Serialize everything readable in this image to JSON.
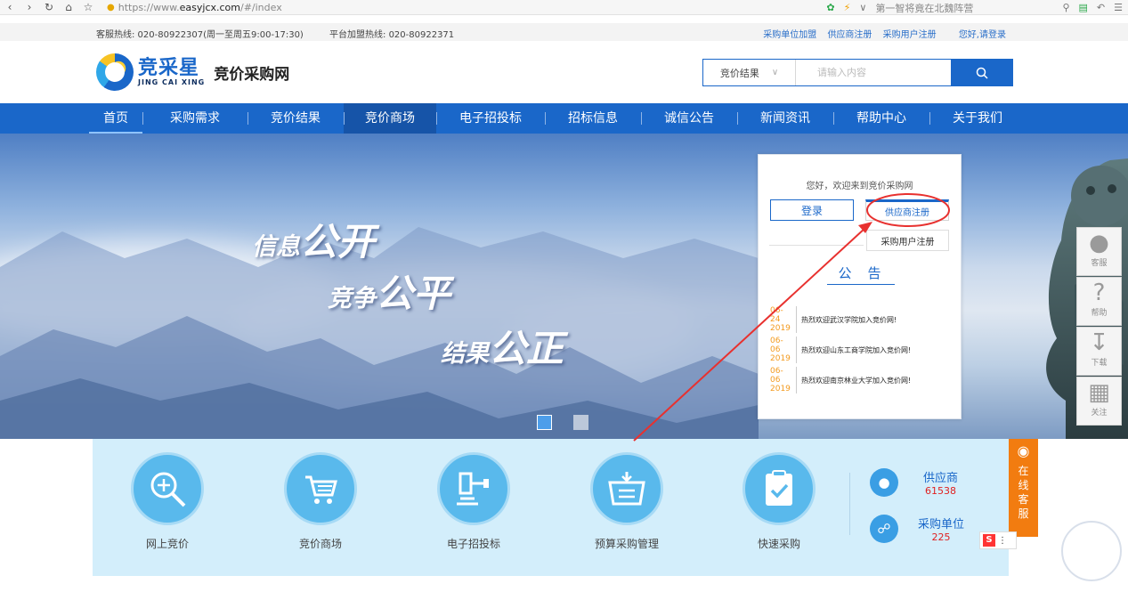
{
  "browser": {
    "url_scheme": "https://www.",
    "url_host": "easyjcx.com",
    "url_path": "/#/index",
    "search_hint": "第一智将竟在北魏阵营"
  },
  "topbar": {
    "hotline": "客服热线: 020-80922307(周一至周五9:00-17:30)",
    "partner_hotline": "平台加盟热线: 020-80922371",
    "links": [
      "采购单位加盟",
      "供应商注册",
      "采购用户注册"
    ],
    "login_prompt": "您好,请登录"
  },
  "header": {
    "logo_cn": "竞采星",
    "logo_en": "JING CAI XING",
    "site_name": "竞价采购网",
    "search_category": "竞价结果",
    "search_placeholder": "请输入内容"
  },
  "nav": {
    "items": [
      {
        "label": "首页",
        "width": 60
      },
      {
        "label": "采购需求",
        "width": 118
      },
      {
        "label": "竞价结果",
        "width": 108
      },
      {
        "label": "竞价商场",
        "width": 104
      },
      {
        "label": "电子招投标",
        "width": 122
      },
      {
        "label": "招标信息",
        "width": 108
      },
      {
        "label": "诚信公告",
        "width": 108
      },
      {
        "label": "新闻资讯",
        "width": 108
      },
      {
        "label": "帮助中心",
        "width": 108
      },
      {
        "label": "关于我们",
        "width": 108
      }
    ],
    "active_index": 3
  },
  "banner": {
    "line1_small": "信息",
    "line1_big": "公开",
    "line2_small": "竞争",
    "line2_big": "公平",
    "line3_small": "结果",
    "line3_big": "公正"
  },
  "login_panel": {
    "welcome": "您好，欢迎来到竞价采购网",
    "login_button": "登录",
    "supplier_register": "供应商注册",
    "buyer_register": "采购用户注册",
    "notice_title": "公告",
    "notices": [
      {
        "date_md": "06-24",
        "date_y": "2019",
        "text": "热烈欢迎武汉学院加入竞价网!"
      },
      {
        "date_md": "06-06",
        "date_y": "2019",
        "text": "热烈欢迎山东工商学院加入竞价网!"
      },
      {
        "date_md": "06-06",
        "date_y": "2019",
        "text": "热烈欢迎南京林业大学加入竞价网!"
      }
    ]
  },
  "side_tools": [
    {
      "icon": "person-icon",
      "label": "客服"
    },
    {
      "icon": "question-icon",
      "label": "帮助"
    },
    {
      "icon": "download-icon",
      "label": "下载"
    },
    {
      "icon": "qrcode-icon",
      "label": "关注"
    }
  ],
  "features": [
    {
      "icon": "magnifier-icon",
      "label": "网上竞价"
    },
    {
      "icon": "cart-icon",
      "label": "竞价商场"
    },
    {
      "icon": "gavel-icon",
      "label": "电子招投标"
    },
    {
      "icon": "basket-icon",
      "label": "预算采购管理"
    },
    {
      "icon": "clipboard-check-icon",
      "label": "快速采购"
    }
  ],
  "stats": {
    "suppliers_label": "供应商",
    "suppliers_count": "61538",
    "buyers_label": "采购单位",
    "buyers_count": "225"
  },
  "online_service": {
    "chars": [
      "在",
      "线",
      "客",
      "服"
    ]
  },
  "colors": {
    "brand_blue": "#1a67c9",
    "accent_orange": "#f27c10",
    "annotation_red": "#e8312f"
  }
}
